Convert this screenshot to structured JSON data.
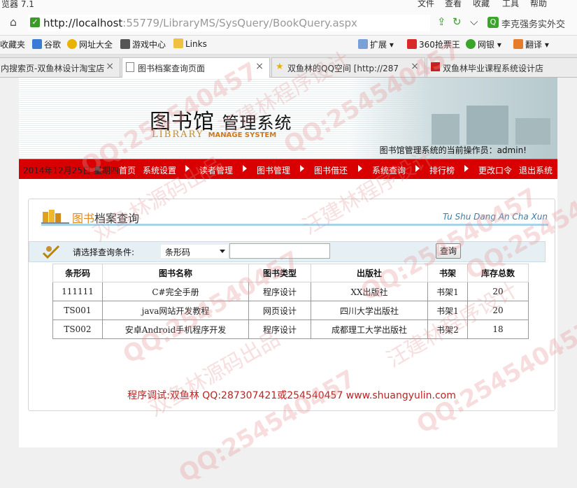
{
  "window": {
    "app_title": "览器 7.1",
    "menus": [
      "文件",
      "查看",
      "收藏",
      "工具",
      "帮助"
    ]
  },
  "address_bar": {
    "url_host": "http://localhost",
    "url_path": ":55779/LibraryMS/SysQuery/BookQuery.aspx",
    "search_text": "李克强务实外交"
  },
  "bookmarks": [
    "收藏夹",
    "谷歌",
    "网址大全",
    "游戏中心",
    "Links",
    "扩展",
    "360抢票王",
    "网银",
    "翻译"
  ],
  "tabs": [
    {
      "label": "内搜索页-双鱼林设计淘宝店",
      "active": false
    },
    {
      "label": "图书档案查询页面",
      "active": true
    },
    {
      "label": "双鱼林的QQ空间 [http://287",
      "active": false
    },
    {
      "label": "双鱼林毕业课程系统设计店",
      "active": false
    }
  ],
  "banner": {
    "logo_cn": "图书馆",
    "logo_cn_sys": "管理系统",
    "logo_en": "LIBRARY",
    "logo_en_bold": "MANAGE SYSTEM",
    "operator_text": "图书馆管理系统的当前操作员：admin!"
  },
  "navbar": {
    "date": "2014年12月25日 星期四",
    "items": [
      "首页",
      "系统设置",
      "读者管理",
      "图书管理",
      "图书借还",
      "系统查询",
      "排行榜",
      "更改口令",
      "退出系统"
    ]
  },
  "panel": {
    "title_orange": "图书",
    "title_rest": "档案查询",
    "title_en": "Tu Shu Dang An Cha Xun"
  },
  "query": {
    "label": "请选择查询条件:",
    "selected": "条形码",
    "input_value": "",
    "button": "查询"
  },
  "table": {
    "headers": [
      "条形码",
      "图书名称",
      "图书类型",
      "出版社",
      "书架",
      "库存总数"
    ],
    "rows": [
      [
        "111111",
        "C#完全手册",
        "程序设计",
        "XX出版社",
        "书架1",
        "20"
      ],
      [
        "TS001",
        "java网站开发教程",
        "网页设计",
        "四川大学出版社",
        "书架1",
        "20"
      ],
      [
        "TS002",
        "安卓Android手机程序开发",
        "程序设计",
        "成都理工大学出版社",
        "书架2",
        "18"
      ]
    ]
  },
  "footer": "程序调试:双鱼林 QQ:287307421或254540457 www.shuangyulin.com",
  "watermarks": [
    "QQ:254540457",
    "汪建林程序设计",
    "双鱼林源码出品"
  ]
}
